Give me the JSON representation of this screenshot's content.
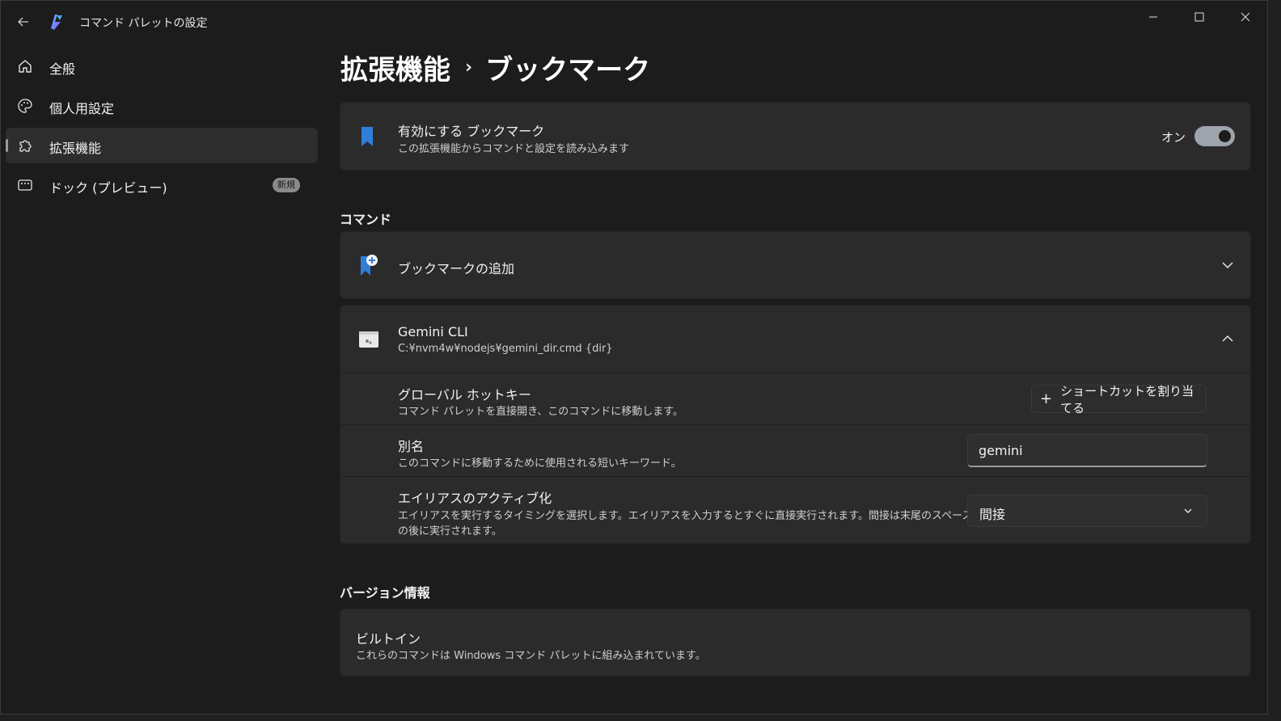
{
  "window": {
    "title": "コマンド パレットの設定"
  },
  "sidebar": {
    "items": [
      {
        "label": "全般",
        "icon": "home-icon"
      },
      {
        "label": "個人用設定",
        "icon": "palette-icon"
      },
      {
        "label": "拡張機能",
        "icon": "puzzle-icon",
        "selected": true
      },
      {
        "label": "ドック (プレビュー)",
        "icon": "dock-icon",
        "badge": "新規"
      }
    ]
  },
  "breadcrumb": {
    "parent": "拡張機能",
    "separator": "›",
    "current": "ブックマーク"
  },
  "extension_card": {
    "title": "有効にする ブックマーク",
    "subtitle": "この拡張機能からコマンドと設定を読み込みます",
    "toggle_label": "オン",
    "toggle_on": true,
    "icon": "bookmark-icon"
  },
  "commands_section": {
    "header": "コマンド",
    "items": [
      {
        "title": "ブックマークの追加",
        "icon": "bookmark-add-icon",
        "expanded": false
      },
      {
        "title": "Gemini CLI",
        "subtitle": "C:¥nvm4w¥nodejs¥gemini_dir.cmd {dir}",
        "icon": "terminal-icon",
        "expanded": true,
        "settings": {
          "hotkey": {
            "title": "グローバル ホットキー",
            "subtitle": "コマンド パレットを直接開き、このコマンドに移動します。",
            "button_label": "ショートカットを割り当てる"
          },
          "alias": {
            "title": "別名",
            "subtitle": "このコマンドに移動するために使用される短いキーワード。",
            "value": "gemini"
          },
          "alias_activation": {
            "title": "エイリアスのアクティブ化",
            "subtitle_line1": "エイリアスを実行するタイミングを選択します。エイリアスを入力するとすぐに直接実行されます。間接は末尾のスペース",
            "subtitle_line2": "の後に実行されます。",
            "selected": "間接"
          }
        }
      }
    ]
  },
  "version_section": {
    "header": "バージョン情報",
    "title": "ビルトイン",
    "subtitle": "これらのコマンドは Windows コマンド パレットに組み込まれています。"
  },
  "colors": {
    "background": "#1c1c1c",
    "card": "#2b2b2b",
    "accent_blue": "#2f7fd8"
  }
}
